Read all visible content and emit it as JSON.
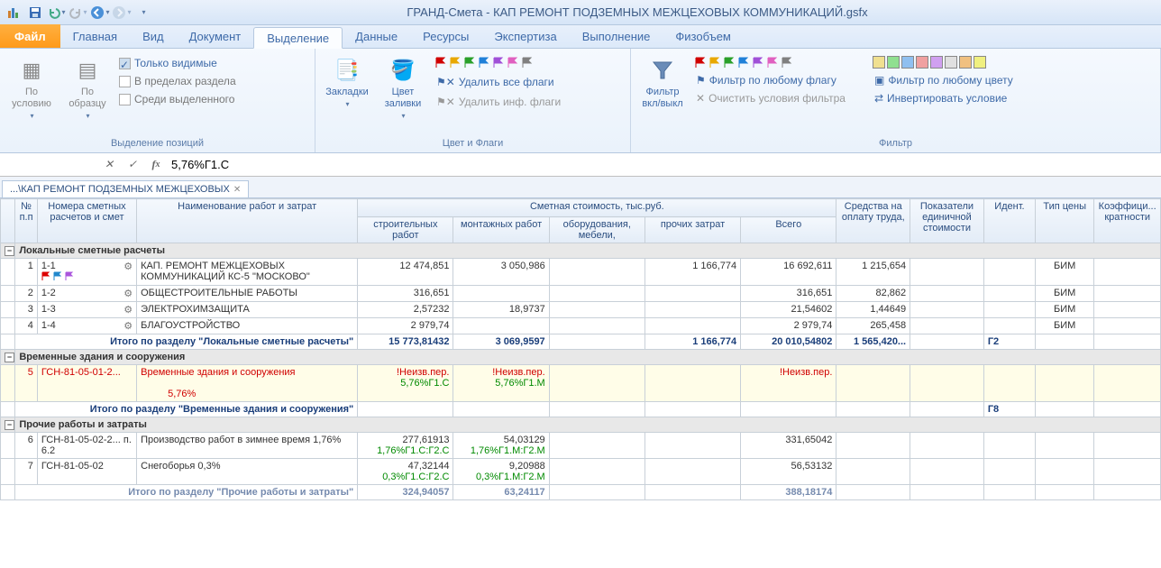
{
  "title": "ГРАНД-Смета - КАП РЕМОНТ ПОДЗЕМНЫХ МЕЖЦЕХОВЫХ КОММУНИКАЦИЙ.gsfx",
  "tabs": {
    "file": "Файл",
    "items": [
      "Главная",
      "Вид",
      "Документ",
      "Выделение",
      "Данные",
      "Ресурсы",
      "Экспертиза",
      "Выполнение",
      "Физобъем"
    ],
    "active": "Выделение"
  },
  "ribbon": {
    "group1": {
      "by_condition": "По условию",
      "by_sample": "По образцу",
      "only_visible": "Только видимые",
      "within_section": "В пределах раздела",
      "among_selected": "Среди выделенного",
      "title": "Выделение позиций"
    },
    "group2": {
      "bookmarks": "Закладки",
      "fill_color": "Цвет заливки",
      "del_all_flags": "Удалить все флаги",
      "del_inf_flags": "Удалить инф. флаги",
      "title": "Цвет и Флаги"
    },
    "group3": {
      "filter_toggle": "Фильтр вкл/выкл",
      "filter_by_flag": "Фильтр по любому флагу",
      "clear_filter": "Очистить условия фильтра",
      "filter_by_color": "Фильтр по любому цвету",
      "invert": "Инвертировать условие",
      "title": "Фильтр"
    }
  },
  "formula": "5,76%Г1.С",
  "doc_tab": "...\\КАП РЕМОНТ ПОДЗЕМНЫХ МЕЖЦЕХОВЫХ",
  "headers": {
    "pp": "№ п.п",
    "num": "Номера сметных расчетов и смет",
    "name": "Наименование работ и затрат",
    "cost_group": "Сметная стоимость, тыс.руб.",
    "c1": "строительных работ",
    "c2": "монтажных работ",
    "c3": "оборудования, мебели,",
    "c4": "прочих затрат",
    "c5": "Всего",
    "sr": "Средства на оплату труда,",
    "pok": "Показатели единичной стоимости",
    "id": "Идент.",
    "tip": "Тип цены",
    "kf": "Коэффици... кратности"
  },
  "sections": {
    "s1": "Локальные сметные расчеты",
    "s2": "Временные здания и сооружения",
    "s3": "Прочие работы и затраты"
  },
  "rows": {
    "r1": {
      "pp": "1",
      "num": "1-1",
      "name": "КАП. РЕМОНТ МЕЖЦЕХОВЫХ КОММУНИКАЦИЙ КС-5 \"МОСКОВО\"",
      "c1": "12 474,851",
      "c2": "3 050,986",
      "c4": "1 166,774",
      "c5": "16 692,611",
      "sr": "1 215,654",
      "tip": "БИМ"
    },
    "r2": {
      "pp": "2",
      "num": "1-2",
      "name": "ОБЩЕСТРОИТЕЛЬНЫЕ РАБОТЫ",
      "c1": "316,651",
      "c5": "316,651",
      "sr": "82,862",
      "tip": "БИМ"
    },
    "r3": {
      "pp": "3",
      "num": "1-3",
      "name": "ЭЛЕКТРОХИМЗАЩИТА",
      "c1": "2,57232",
      "c2": "18,9737",
      "c5": "21,54602",
      "sr": "1,44649",
      "tip": "БИМ"
    },
    "r4": {
      "pp": "4",
      "num": "1-4",
      "name": "БЛАГОУСТРОЙСТВО",
      "c1": "2 979,74",
      "c5": "2 979,74",
      "sr": "265,458",
      "tip": "БИМ"
    },
    "t1": {
      "label": "Итого по разделу \"Локальные сметные расчеты\"",
      "c1": "15 773,81432",
      "c2": "3 069,9597",
      "c4": "1 166,774",
      "c5": "20 010,54802",
      "sr": "1 565,420...",
      "id": "Г2"
    },
    "r5": {
      "pp": "5",
      "num": "ГСН-81-05-01-2...",
      "name": "Временные здания и сооружения",
      "pct": "5,76%",
      "c1a": "!Неизв.пер.",
      "c1b": "5,76%Г1.С",
      "c2a": "!Неизв.пер.",
      "c2b": "5,76%Г1.М",
      "c5a": "!Неизв.пер."
    },
    "t2": {
      "label": "Итого по разделу \"Временные здания и сооружения\"",
      "id": "Г8"
    },
    "r6": {
      "pp": "6",
      "num": "ГСН-81-05-02-2... п. 6.2",
      "name": "Производство работ в зимнее время 1,76%",
      "c1": "277,61913",
      "c1b": "1,76%Г1.С:Г2.С",
      "c2": "54,03129",
      "c2b": "1,76%Г1.М:Г2.М",
      "c5": "331,65042"
    },
    "r7": {
      "pp": "7",
      "num": "ГСН-81-05-02",
      "name": "Снегоборья  0,3%",
      "c1": "47,32144",
      "c1b": "0,3%Г1.С:Г2.С",
      "c2": "9,20988",
      "c2b": "0,3%Г1.М:Г2.М",
      "c5": "56,53132"
    },
    "t3": {
      "label": "Итого по разделу \"Прочие работы и затраты\"",
      "c1": "324,94057",
      "c2": "63,24117",
      "c5": "388,18174"
    }
  },
  "flag_colors": [
    "#d00000",
    "#e8a800",
    "#2aa02a",
    "#2080d8",
    "#a050d8",
    "#e060c0",
    "#808080"
  ],
  "color_sq": [
    "#f0e090",
    "#90e090",
    "#90c0f0",
    "#f0a0a0",
    "#d0a0f0",
    "#e0e0e0",
    "#f0c080",
    "#f0f080"
  ]
}
